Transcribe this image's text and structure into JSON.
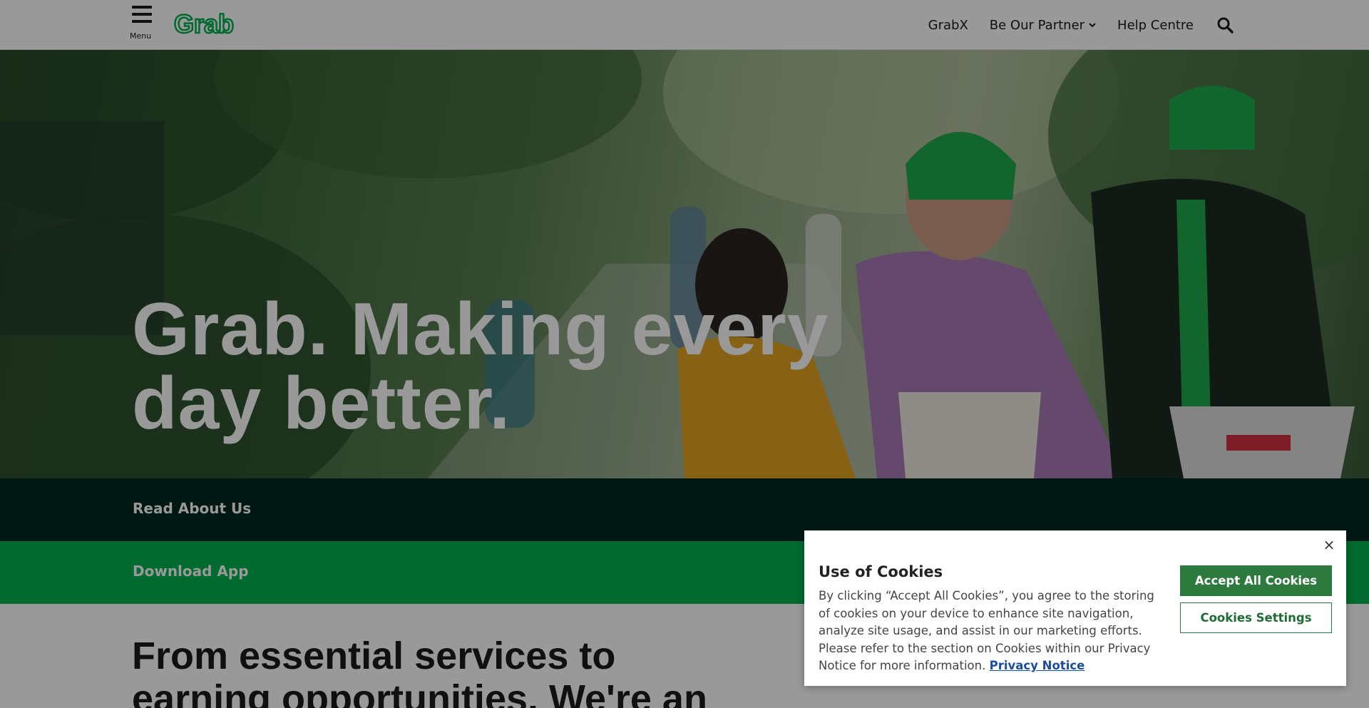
{
  "header": {
    "menu_label": "Menu",
    "logo_text": "Grab",
    "nav": [
      {
        "label": "GrabX"
      },
      {
        "label": "Be Our Partner"
      },
      {
        "label": "Help Centre"
      }
    ]
  },
  "hero": {
    "title_line1": "Grab. Making every",
    "title_line2": "day better."
  },
  "links": {
    "read_about": "Read About Us",
    "download_app": "Download App"
  },
  "intro": {
    "line1": "From essential services to",
    "line2": "earning opportunities. We're an"
  },
  "cookie_banner": {
    "title": "Use of Cookies",
    "body": "By clicking “Accept All Cookies”, you agree to the storing of cookies on your device to enhance site navigation, analyze site usage, and assist in our marketing efforts. Please refer to the section on Cookies within our Privacy Notice for more information.",
    "privacy_link": "Privacy Notice",
    "accept_label": "Accept All Cookies",
    "settings_label": "Cookies Settings",
    "close_symbol": "×"
  },
  "colors": {
    "brand_green": "#00b14f",
    "dark_band": "#00281f",
    "accept_button": "#2d7a3e"
  }
}
